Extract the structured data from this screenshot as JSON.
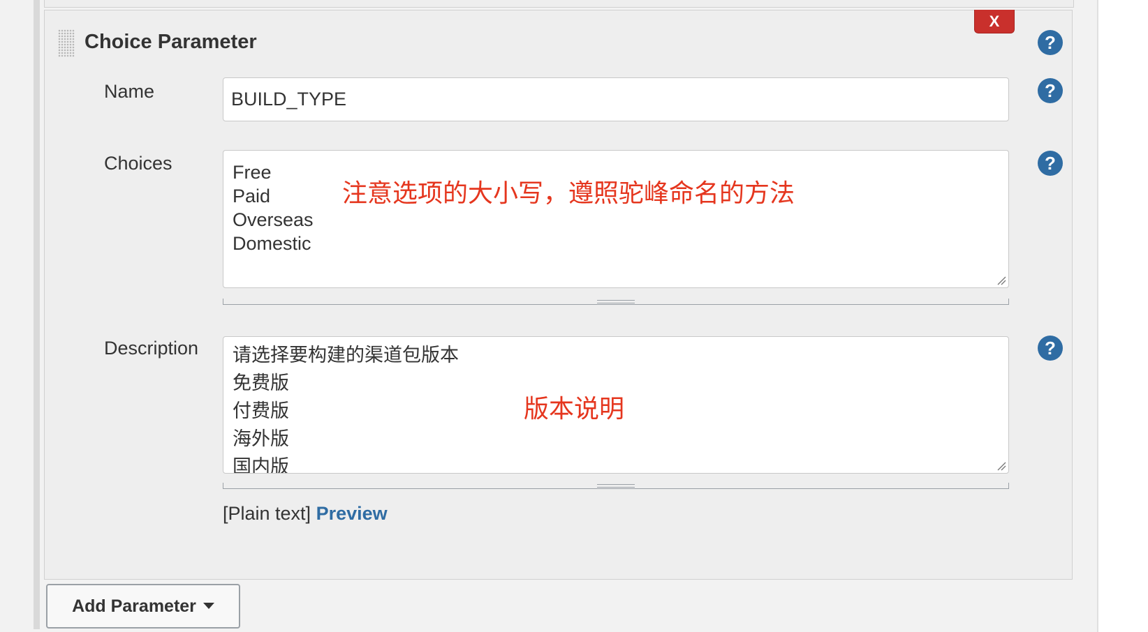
{
  "parameter": {
    "title": "Choice Parameter",
    "delete_label": "X",
    "help_icon_glyph": "?",
    "accent_color": "#2f6ca3",
    "delete_color": "#c9302c"
  },
  "fields": {
    "name": {
      "label": "Name",
      "value": "BUILD_TYPE"
    },
    "choices": {
      "label": "Choices",
      "lines": [
        "Free",
        "Paid",
        "Overseas",
        "Domestic"
      ]
    },
    "description": {
      "label": "Description",
      "lines": [
        "请选择要构建的渠道包版本",
        "免费版",
        "付费版",
        "海外版",
        "国内版"
      ]
    }
  },
  "annotations": {
    "choices_note": "注意选项的大小写，遵照驼峰命名的方法",
    "description_note": "版本说明",
    "color": "#e5361e"
  },
  "markup": {
    "format_label": "[Plain text]",
    "preview_label": "Preview"
  },
  "add_parameter": {
    "label": "Add Parameter",
    "icon": "caret-down-icon"
  }
}
